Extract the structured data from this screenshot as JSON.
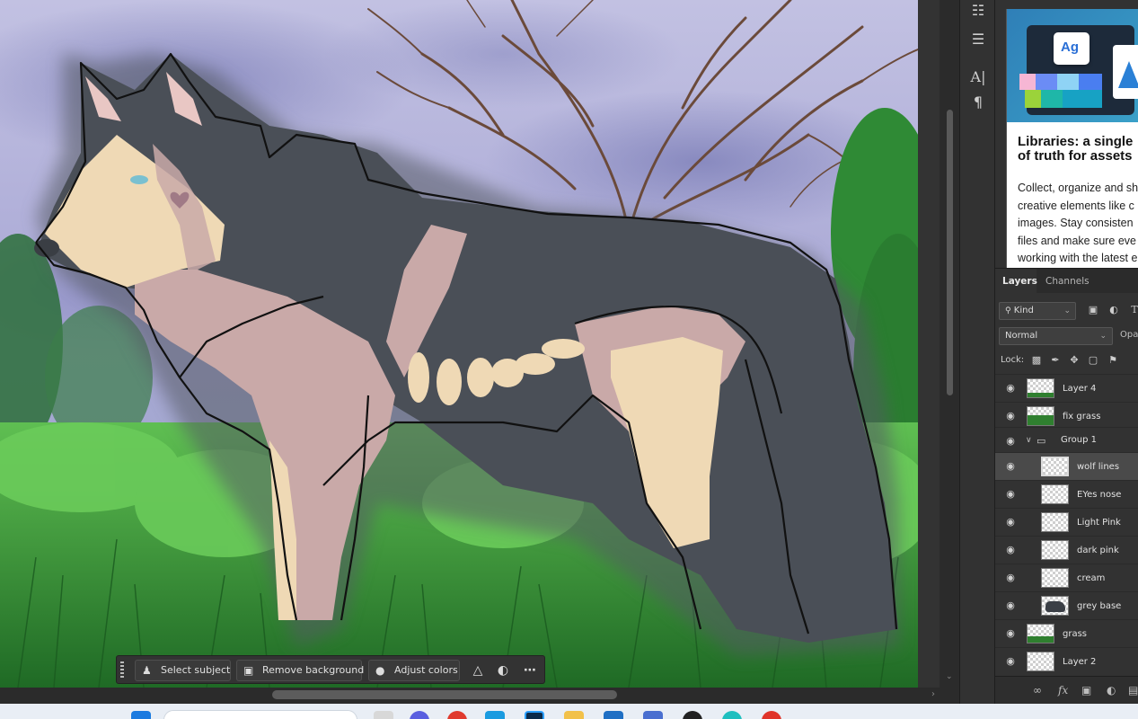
{
  "canvas": {
    "scene": "wolf-in-forest-illustration"
  },
  "toolstrip": {
    "icons": [
      "properties-icon",
      "paragraph-styles-icon",
      "character-icon",
      "paragraph-icon"
    ]
  },
  "learn_panel": {
    "title": "Libraries: a single\nof truth for assets",
    "body": "Collect, organize and sh\ncreative elements like c\nimages. Stay consisten\nfiles and make sure eve\nworking with the latest e",
    "badge_text": "Ag"
  },
  "layers_panel": {
    "tabs": [
      {
        "label": "Layers",
        "active": true
      },
      {
        "label": "Channels",
        "active": false
      }
    ],
    "filter_kind": "Kind",
    "blend_mode": "Normal",
    "opacity_label": "Opac",
    "lock_label": "Lock:",
    "layers": [
      {
        "name": "Layer 4",
        "type": "layer",
        "indent": 0,
        "selected": false,
        "thumb": "green-strip"
      },
      {
        "name": "fix grass",
        "type": "layer",
        "indent": 0,
        "selected": false,
        "thumb": "green"
      },
      {
        "name": "Group 1",
        "type": "group",
        "indent": 0,
        "selected": false
      },
      {
        "name": "wolf lines",
        "type": "layer",
        "indent": 1,
        "selected": true,
        "thumb": "transparent"
      },
      {
        "name": "EYes nose",
        "type": "layer",
        "indent": 1,
        "selected": false,
        "thumb": "transparent"
      },
      {
        "name": "Light Pink",
        "type": "layer",
        "indent": 1,
        "selected": false,
        "thumb": "transparent"
      },
      {
        "name": "dark pink",
        "type": "layer",
        "indent": 1,
        "selected": false,
        "thumb": "transparent"
      },
      {
        "name": "cream",
        "type": "layer",
        "indent": 1,
        "selected": false,
        "thumb": "transparent"
      },
      {
        "name": "grey base",
        "type": "layer",
        "indent": 1,
        "selected": false,
        "thumb": "wolf"
      },
      {
        "name": "grass",
        "type": "layer",
        "indent": 0,
        "selected": false,
        "thumb": "green-low"
      },
      {
        "name": "Layer 2",
        "type": "layer",
        "indent": 0,
        "selected": false,
        "thumb": "transparent"
      }
    ]
  },
  "context_bar": {
    "select_subject": "Select subject",
    "remove_background": "Remove background",
    "adjust_colors": "Adjust colors"
  },
  "colors": {
    "wolf_grey": "#4a4f57",
    "wolf_pink": "#c9a9a8",
    "wolf_cream": "#efd9b5",
    "sky": "#a9a9d6",
    "grass": "#3f9a3a",
    "panel_bg": "#323232"
  }
}
